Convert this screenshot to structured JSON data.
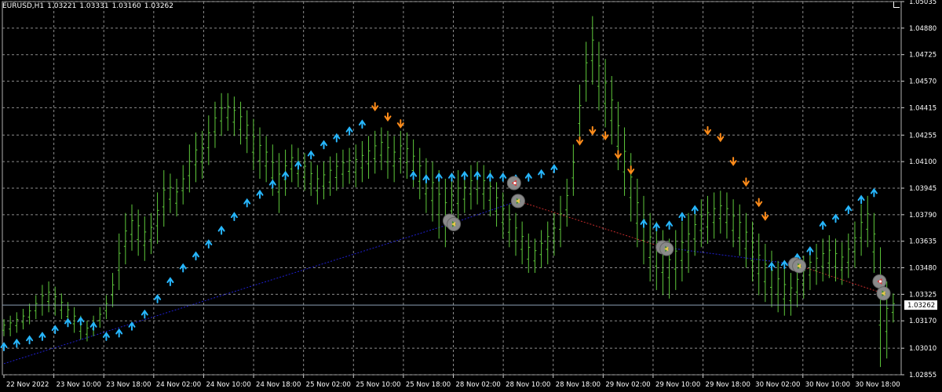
{
  "header": {
    "symbol": "EURUSD,H1",
    "open": "1.03221",
    "high": "1.03331",
    "low": "1.03160",
    "close": "1.03262"
  },
  "colors": {
    "background": "#000000",
    "grid": "#8c8c8c",
    "bar": "#5ec93b",
    "up_arrow": "#27b7ff",
    "down_arrow": "#ff8c1a",
    "trend_up_line": "#1f1fd0",
    "trend_down_line": "#c02a2a",
    "price_line": "#8ca0b4",
    "text": "#ffffff",
    "signal_circle": "#8a8a8a"
  },
  "chart_data": {
    "type": "ohlc",
    "symbol": "EURUSD",
    "timeframe": "H1",
    "current_price": "1.03262",
    "x_ticks": [
      "22 Nov 2022",
      "23 Nov 10:00",
      "23 Nov 18:00",
      "24 Nov 02:00",
      "24 Nov 10:00",
      "24 Nov 18:00",
      "25 Nov 02:00",
      "25 Nov 10:00",
      "25 Nov 18:00",
      "28 Nov 02:00",
      "28 Nov 10:00",
      "28 Nov 18:00",
      "29 Nov 02:00",
      "29 Nov 10:00",
      "29 Nov 18:00",
      "30 Nov 02:00",
      "30 Nov 10:00",
      "30 Nov 18:00"
    ],
    "y_ticks": [
      "1.05035",
      "1.04880",
      "1.04725",
      "1.04570",
      "1.04415",
      "1.04255",
      "1.04100",
      "1.03945",
      "1.03790",
      "1.03635",
      "1.03480",
      "1.03325",
      "1.03170",
      "1.03010",
      "1.02855"
    ],
    "y_range": [
      1.02855,
      1.05035
    ],
    "bar_count": 139,
    "bars_hl": [
      [
        1.0318,
        1.0308
      ],
      [
        1.032,
        1.0308
      ],
      [
        1.0322,
        1.031
      ],
      [
        1.0324,
        1.0312
      ],
      [
        1.0327,
        1.0315
      ],
      [
        1.0332,
        1.0318
      ],
      [
        1.0338,
        1.032
      ],
      [
        1.034,
        1.0322
      ],
      [
        1.0337,
        1.032
      ],
      [
        1.0333,
        1.0318
      ],
      [
        1.0328,
        1.0315
      ],
      [
        1.0325,
        1.031
      ],
      [
        1.032,
        1.0306
      ],
      [
        1.0317,
        1.0305
      ],
      [
        1.032,
        1.0308
      ],
      [
        1.0325,
        1.0313
      ],
      [
        1.0332,
        1.0318
      ],
      [
        1.0345,
        1.0325
      ],
      [
        1.0368,
        1.0335
      ],
      [
        1.038,
        1.035
      ],
      [
        1.0385,
        1.0358
      ],
      [
        1.0382,
        1.0355
      ],
      [
        1.0378,
        1.0352
      ],
      [
        1.038,
        1.0356
      ],
      [
        1.0392,
        1.0362
      ],
      [
        1.0405,
        1.0372
      ],
      [
        1.0403,
        1.038
      ],
      [
        1.04,
        1.0378
      ],
      [
        1.0408,
        1.0385
      ],
      [
        1.042,
        1.0392
      ],
      [
        1.0427,
        1.0398
      ],
      [
        1.0428,
        1.04
      ],
      [
        1.0437,
        1.0408
      ],
      [
        1.0445,
        1.0418
      ],
      [
        1.045,
        1.0425
      ],
      [
        1.045,
        1.0428
      ],
      [
        1.0448,
        1.0425
      ],
      [
        1.0445,
        1.042
      ],
      [
        1.044,
        1.0415
      ],
      [
        1.0435,
        1.0405
      ],
      [
        1.043,
        1.04
      ],
      [
        1.0425,
        1.0398
      ],
      [
        1.042,
        1.039
      ],
      [
        1.0415,
        1.038
      ],
      [
        1.0417,
        1.039
      ],
      [
        1.042,
        1.0398
      ],
      [
        1.0418,
        1.0395
      ],
      [
        1.0415,
        1.0393
      ],
      [
        1.041,
        1.039
      ],
      [
        1.0408,
        1.0385
      ],
      [
        1.041,
        1.0388
      ],
      [
        1.0413,
        1.039
      ],
      [
        1.0415,
        1.0393
      ],
      [
        1.0417,
        1.0395
      ],
      [
        1.0418,
        1.0397
      ],
      [
        1.042,
        1.0395
      ],
      [
        1.0422,
        1.0398
      ],
      [
        1.0425,
        1.04
      ],
      [
        1.0428,
        1.0403
      ],
      [
        1.043,
        1.0405
      ],
      [
        1.0428,
        1.04
      ],
      [
        1.0425,
        1.0398
      ],
      [
        1.0428,
        1.0403
      ],
      [
        1.0427,
        1.04
      ],
      [
        1.0423,
        1.0395
      ],
      [
        1.0418,
        1.0388
      ],
      [
        1.0412,
        1.038
      ],
      [
        1.041,
        1.0375
      ],
      [
        1.0405,
        1.0365
      ],
      [
        1.04,
        1.036
      ],
      [
        1.0402,
        1.037
      ],
      [
        1.0405,
        1.0375
      ],
      [
        1.0403,
        1.038
      ],
      [
        1.0408,
        1.0382
      ],
      [
        1.041,
        1.0385
      ],
      [
        1.0408,
        1.0382
      ],
      [
        1.0405,
        1.0378
      ],
      [
        1.0398,
        1.0372
      ],
      [
        1.0392,
        1.0365
      ],
      [
        1.0385,
        1.036
      ],
      [
        1.038,
        1.0355
      ],
      [
        1.0375,
        1.035
      ],
      [
        1.0368,
        1.0345
      ],
      [
        1.0365,
        1.0345
      ],
      [
        1.037,
        1.0348
      ],
      [
        1.0375,
        1.035
      ],
      [
        1.038,
        1.0355
      ],
      [
        1.039,
        1.036
      ],
      [
        1.04,
        1.0372
      ],
      [
        1.042,
        1.039
      ],
      [
        1.0455,
        1.042
      ],
      [
        1.048,
        1.0445
      ],
      [
        1.0495,
        1.0455
      ],
      [
        1.048,
        1.044
      ],
      [
        1.047,
        1.043
      ],
      [
        1.046,
        1.042
      ],
      [
        1.0445,
        1.0405
      ],
      [
        1.043,
        1.039
      ],
      [
        1.0415,
        1.0375
      ],
      [
        1.04,
        1.036
      ],
      [
        1.039,
        1.035
      ],
      [
        1.038,
        1.034
      ],
      [
        1.0375,
        1.0335
      ],
      [
        1.037,
        1.0332
      ],
      [
        1.0365,
        1.033
      ],
      [
        1.037,
        1.0335
      ],
      [
        1.0375,
        1.034
      ],
      [
        1.038,
        1.0345
      ],
      [
        1.0383,
        1.0355
      ],
      [
        1.0388,
        1.036
      ],
      [
        1.039,
        1.0362
      ],
      [
        1.0392,
        1.0365
      ],
      [
        1.0393,
        1.0368
      ],
      [
        1.0392,
        1.0365
      ],
      [
        1.0388,
        1.036
      ],
      [
        1.0385,
        1.0355
      ],
      [
        1.038,
        1.0348
      ],
      [
        1.0375,
        1.034
      ],
      [
        1.0368,
        1.0332
      ],
      [
        1.0362,
        1.0328
      ],
      [
        1.0358,
        1.0325
      ],
      [
        1.0352,
        1.0322
      ],
      [
        1.0348,
        1.032
      ],
      [
        1.0345,
        1.032
      ],
      [
        1.035,
        1.0325
      ],
      [
        1.0355,
        1.033
      ],
      [
        1.036,
        1.0335
      ],
      [
        1.0362,
        1.0338
      ],
      [
        1.0365,
        1.034
      ],
      [
        1.0367,
        1.0342
      ],
      [
        1.0365,
        1.034
      ],
      [
        1.0363,
        1.0338
      ],
      [
        1.0368,
        1.0342
      ],
      [
        1.0375,
        1.0348
      ],
      [
        1.0385,
        1.0355
      ],
      [
        1.039,
        1.036
      ],
      [
        1.038,
        1.0345
      ],
      [
        1.036,
        1.029
      ],
      [
        1.034,
        1.0295
      ],
      [
        1.0333,
        1.0316
      ]
    ],
    "up_arrows": [
      [
        0,
        1.0302
      ],
      [
        2,
        1.0304
      ],
      [
        4,
        1.0306
      ],
      [
        6,
        1.0308
      ],
      [
        8,
        1.0312
      ],
      [
        10,
        1.0316
      ],
      [
        12,
        1.0317
      ],
      [
        14,
        1.0314
      ],
      [
        16,
        1.0308
      ],
      [
        18,
        1.031
      ],
      [
        20,
        1.0314
      ],
      [
        22,
        1.0321
      ],
      [
        24,
        1.033
      ],
      [
        26,
        1.034
      ],
      [
        28,
        1.0348
      ],
      [
        30,
        1.0355
      ],
      [
        32,
        1.0362
      ],
      [
        34,
        1.037
      ],
      [
        36,
        1.0378
      ],
      [
        38,
        1.0386
      ],
      [
        40,
        1.0391
      ],
      [
        42,
        1.0397
      ],
      [
        44,
        1.0402
      ],
      [
        46,
        1.0408
      ],
      [
        48,
        1.0414
      ],
      [
        50,
        1.042
      ],
      [
        52,
        1.0424
      ],
      [
        54,
        1.0428
      ],
      [
        56,
        1.0432
      ],
      [
        64,
        1.0402
      ],
      [
        66,
        1.04
      ],
      [
        68,
        1.0401
      ],
      [
        70,
        1.0401
      ],
      [
        72,
        1.0402
      ],
      [
        74,
        1.0402
      ],
      [
        76,
        1.0401
      ],
      [
        78,
        1.0401
      ],
      [
        80,
        1.04
      ],
      [
        82,
        1.0401
      ],
      [
        84,
        1.0403
      ],
      [
        86,
        1.0406
      ],
      [
        100,
        1.0374
      ],
      [
        102,
        1.0372
      ],
      [
        104,
        1.0373
      ],
      [
        106,
        1.0378
      ],
      [
        108,
        1.0382
      ],
      [
        120,
        1.0349
      ],
      [
        122,
        1.035
      ],
      [
        124,
        1.0354
      ],
      [
        126,
        1.0358
      ],
      [
        128,
        1.0373
      ],
      [
        130,
        1.0377
      ],
      [
        132,
        1.0382
      ],
      [
        134,
        1.0388
      ],
      [
        136,
        1.0392
      ]
    ],
    "down_arrows": [
      [
        58,
        1.0442
      ],
      [
        60,
        1.0436
      ],
      [
        62,
        1.0432
      ],
      [
        90,
        1.0422
      ],
      [
        92,
        1.0428
      ],
      [
        94,
        1.0425
      ],
      [
        96,
        1.0414
      ],
      [
        98,
        1.0405
      ],
      [
        110,
        1.0428
      ],
      [
        112,
        1.0424
      ],
      [
        114,
        1.041
      ],
      [
        116,
        1.0398
      ],
      [
        118,
        1.0386
      ],
      [
        119,
        1.0378
      ]
    ],
    "signal_markers": [
      {
        "index": 111,
        "price": 1.03755,
        "direction": "sell"
      },
      {
        "index": 112,
        "price": 1.03735,
        "direction": "buy"
      },
      {
        "index": 127,
        "price": 1.03975,
        "direction": "sell"
      },
      {
        "index": 128,
        "price": 1.0387,
        "direction": "buy"
      },
      {
        "index": 164,
        "price": 1.036,
        "direction": "sell"
      },
      {
        "index": 165,
        "price": 1.0359,
        "direction": "buy"
      },
      {
        "index": 197,
        "price": 1.035,
        "direction": "sell"
      },
      {
        "index": 198,
        "price": 1.0349,
        "direction": "buy"
      },
      {
        "index": 218,
        "price": 1.034,
        "direction": "sell"
      },
      {
        "index": 219,
        "price": 1.0333,
        "direction": "buy"
      }
    ]
  }
}
